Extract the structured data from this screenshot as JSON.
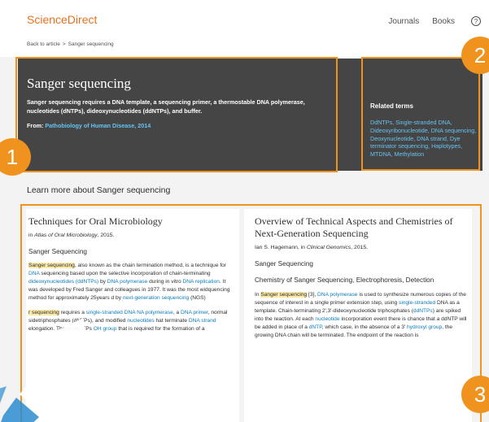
{
  "header": {
    "brand": "ScienceDirect",
    "nav": [
      "Journals",
      "Books"
    ],
    "help_icon": "?",
    "breadcrumb_back": "Back to article",
    "breadcrumb_sep": ">",
    "breadcrumb_current": "Sanger sequencing"
  },
  "topic": {
    "title": "Sanger sequencing",
    "definition": "Sanger sequencing requires a DNA template, a sequencing primer, a thermostable DNA polymerase, nucleotides (dNTPs), dideoxynucleotides (ddNTPs), and buffer.",
    "from_label": "From:",
    "from_source": "Pathobiology of Human Disease, 2014"
  },
  "related": {
    "heading": "Related terms",
    "terms": "DdNTPs, Single-stranded DNA, Dideoxyribonucleotide, DNA sequencing, Deoxynucleotide, DNA strand, Dye terminator sequencing, Haplotypes, MTDNA, Methylation"
  },
  "learn_more": "Learn more about Sanger sequencing",
  "cards": {
    "left": {
      "title": "Techniques for Oral Microbiology",
      "source_prefix": "in",
      "source_book": "Atlas of Oral Microbiology",
      "source_year": ", 2015.",
      "section": "Sanger Sequencing",
      "p1_hl": "Sanger sequencing",
      "p1_a": ", also known as the chain termination method, is a technique for ",
      "p1_link1": "DNA",
      "p1_b": " sequencing based upon the selective incorporation of chain-terminating ",
      "p1_link2": "dideoxynucleotides (ddNTPs)",
      "p1_c": " by ",
      "p1_link3": "DNA polymerase",
      "p1_d": " during in vitro ",
      "p1_link4": "DNA replication",
      "p1_e": ". It was developed by Fred",
      "p1_f": " Sanger and colleagues in 1977. It was the most wid",
      "p1_g": "quencing method for approximately 25years",
      "p1_h": "d by ",
      "p1_link5": "next-generation sequencing",
      "p1_i": " (NGS)",
      "p2_hl": "r sequencing",
      "p2_a": " requires a ",
      "p2_link1": "single-stranded DNA",
      "p2_b": "NA polymerase",
      "p2_c": ", a ",
      "p2_link2": "DNA primer",
      "p2_d": ", normal",
      "p2_e": "sidetriphosphates (dNTPs), and modified ",
      "p2_link3": "nucleotides",
      "p2_f": "hat terminate ",
      "p2_link4": "DNA strand",
      "p2_g": " elongation. These ddNTPs",
      "p2_h": "OH group",
      "p2_i": " that is required for the formation of a"
    },
    "right": {
      "title": "Overview of Technical Aspects and Chemistries of Next-Generation Sequencing",
      "source_author": "Ian S. Hagemann, in",
      "source_book": "Clinical Genomics",
      "source_year": ", 2015.",
      "section": "Sanger Sequencing",
      "subsection": "Chemistry of Sanger Sequencing, Electrophoresis, Detection",
      "p_a": "In ",
      "p_hl": "Sanger sequencing",
      "p_b": " [3], ",
      "p_link1": "DNA polymerase",
      "p_c": " is used to synthesize numerous copies of the sequence of interest in a single primer extension step, using ",
      "p_link2": "single-stranded",
      "p_d": " DNA as a template. Chain-terminating 2′,3′-dideoxynucleotide triphosphates (",
      "p_link3": "ddNTPs",
      "p_e": ") are spiked into the reaction. At each ",
      "p_link4": "nucleotide",
      "p_f": " incorporation event there is chance that a ddNTP will be added in place of a ",
      "p_link5": "dNTP",
      "p_g": ", which case, in the absence of a 3′ ",
      "p_link6": "hydroxyl group",
      "p_h": ", the growing DNA chain will be terminated. The endpoint of the reaction is"
    }
  },
  "annotations": [
    "1",
    "2",
    "3"
  ],
  "colors": {
    "brand": "#e9711c",
    "header_bg": "#454545",
    "link": "#0c7dbb",
    "header_link": "#66c3f2",
    "highlight": "#fbe9a8",
    "annotation": "#f0931e"
  }
}
